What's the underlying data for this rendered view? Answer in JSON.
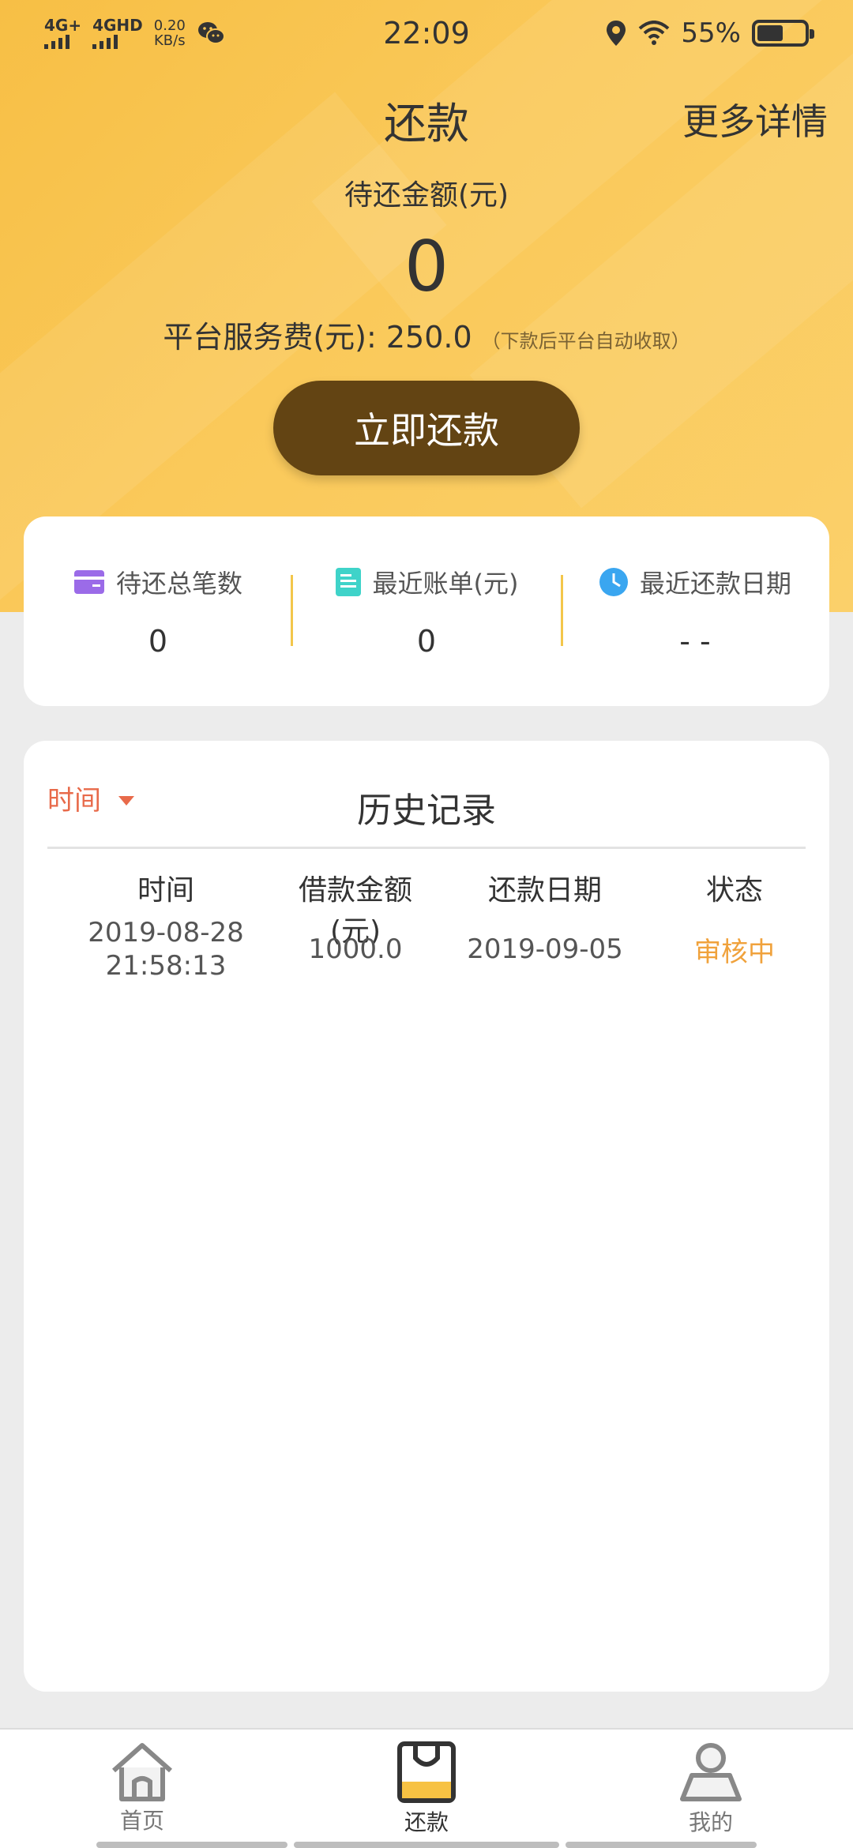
{
  "status_bar": {
    "signal1": "4G+",
    "signal2": "4GHD",
    "speed_value": "0.20",
    "speed_unit": "KB/s",
    "time": "22:09",
    "battery": "55%",
    "battery_level": 0.55,
    "icons": [
      "wechat-icon",
      "location-icon",
      "wifi-icon",
      "battery-icon"
    ]
  },
  "header": {
    "title": "还款",
    "more": "更多详情",
    "pending_label": "待还金额(元)",
    "pending_amount": "0",
    "fee_label": "平台服务费(元): 250.0",
    "fee_note": "（下款后平台自动收取）",
    "repay_button": "立即还款"
  },
  "stats": [
    {
      "icon": "card-icon",
      "label": "待还总笔数",
      "value": "0"
    },
    {
      "icon": "bill-icon",
      "label": "最近账单(元)",
      "value": "0"
    },
    {
      "icon": "clock-icon",
      "label": "最近还款日期",
      "value": "- -"
    }
  ],
  "history": {
    "filter_label": "时间",
    "title": "历史记录",
    "columns": [
      "时间",
      "借款金额(元)",
      "还款日期",
      "状态"
    ],
    "rows": [
      {
        "date": "2019-08-28",
        "clock": "21:58:13",
        "amount": "1000.0",
        "repay_date": "2019-09-05",
        "status": "审核中"
      }
    ]
  },
  "tabbar": {
    "items": [
      {
        "icon": "home-icon",
        "label": "首页"
      },
      {
        "icon": "bag-icon",
        "label": "还款"
      },
      {
        "icon": "profile-icon",
        "label": "我的"
      }
    ],
    "active": "还款"
  },
  "colors": {
    "header_yellow": "#f7bf45",
    "button_brown": "#634413",
    "filter_red": "#e86a4a",
    "status_orange": "#f0a23c",
    "divider_yellow": "#f3c64a"
  }
}
